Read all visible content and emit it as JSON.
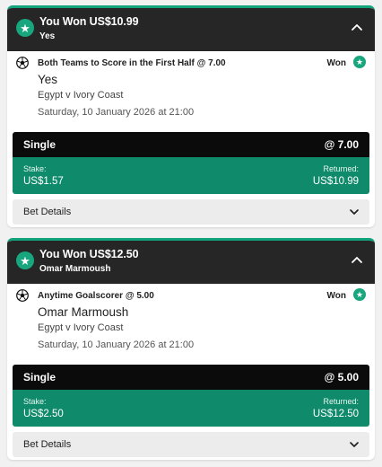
{
  "bets": [
    {
      "header": {
        "title": "You Won US$10.99",
        "subtitle": "Yes"
      },
      "selection": {
        "market": "Both Teams to Score in the First Half @ 7.00",
        "status": "Won",
        "pick": "Yes",
        "event": "Egypt v Ivory Coast",
        "date": "Saturday, 10 January 2026 at 21:00"
      },
      "summary": {
        "type": "Single",
        "odds": "@ 7.00",
        "stake_label": "Stake:",
        "stake_value": "US$1.57",
        "returned_label": "Returned:",
        "returned_value": "US$10.99"
      },
      "details_label": "Bet Details"
    },
    {
      "header": {
        "title": "You Won US$12.50",
        "subtitle": "Omar Marmoush"
      },
      "selection": {
        "market": "Anytime Goalscorer @ 5.00",
        "status": "Won",
        "pick": "Omar Marmoush",
        "event": "Egypt v Ivory Coast",
        "date": "Saturday, 10 January 2026 at 21:00"
      },
      "summary": {
        "type": "Single",
        "odds": "@ 5.00",
        "stake_label": "Stake:",
        "stake_value": "US$2.50",
        "returned_label": "Returned:",
        "returned_value": "US$12.50"
      },
      "details_label": "Bet Details"
    }
  ],
  "icons": {
    "win_badge": "star-icon",
    "sport": "football-icon",
    "collapse": "chevron-up-icon",
    "expand": "chevron-down-icon"
  },
  "colors": {
    "accent_green": "#18a67e",
    "stake_bar": "#0f8a6b",
    "header_bg": "#262626",
    "single_bar": "#0b0b0b"
  }
}
